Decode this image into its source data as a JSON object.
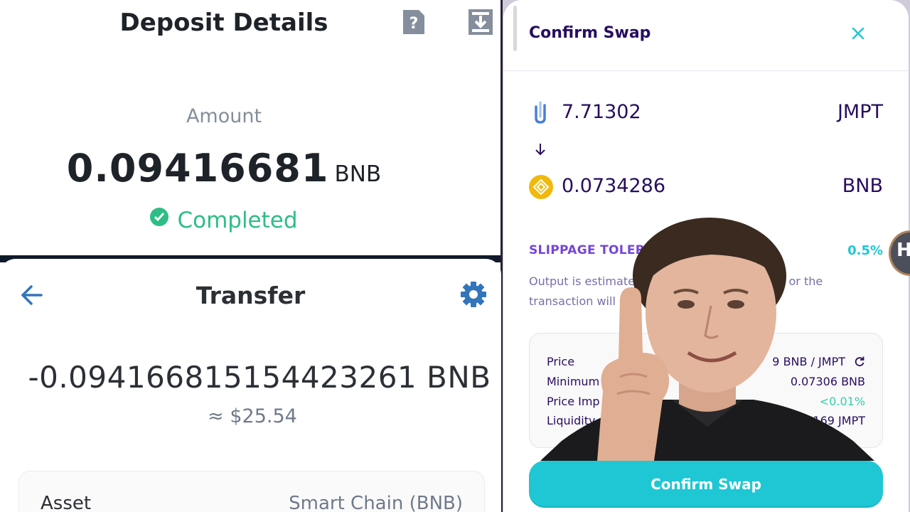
{
  "deposit": {
    "title": "Deposit Details",
    "amount_label": "Amount",
    "amount_value": "0.09416681",
    "amount_unit": "BNB",
    "status": "Completed",
    "help_icon": "help-document-icon",
    "export_icon": "export-icon"
  },
  "transfer": {
    "title": "Transfer",
    "amount": "-0.094166815154423261 BNB",
    "fiat": "≈ $25.54",
    "asset_label": "Asset",
    "asset_value": "Smart Chain (BNB)"
  },
  "swap": {
    "title": "Confirm Swap",
    "from": {
      "amount": "7.71302",
      "symbol": "JMPT"
    },
    "to": {
      "amount": "0.0734286",
      "symbol": "BNB"
    },
    "slippage_label": "SLIPPAGE TOLERAN",
    "slippage_value": "0.5%",
    "note_line1": "Output is estimated",
    "note_line1_end": "ast or the",
    "note_line2": "transaction will r",
    "details": [
      {
        "label": "Price",
        "value": "9 BNB / JMPT"
      },
      {
        "label": "Minimum",
        "value": "0.07306 BNB"
      },
      {
        "label": "Price Imp",
        "value": "<0.01%"
      },
      {
        "label": "Liquidity",
        "value": "85169 JMPT"
      }
    ],
    "confirm_label": "Confirm Swap"
  },
  "badge": {
    "letter": "H"
  },
  "colors": {
    "binance_green": "#2ebd85",
    "pancake_purple": "#7645d9",
    "pancake_teal": "#1fc7d4",
    "pancake_text": "#280d5f",
    "trust_blue": "#3375bb"
  }
}
